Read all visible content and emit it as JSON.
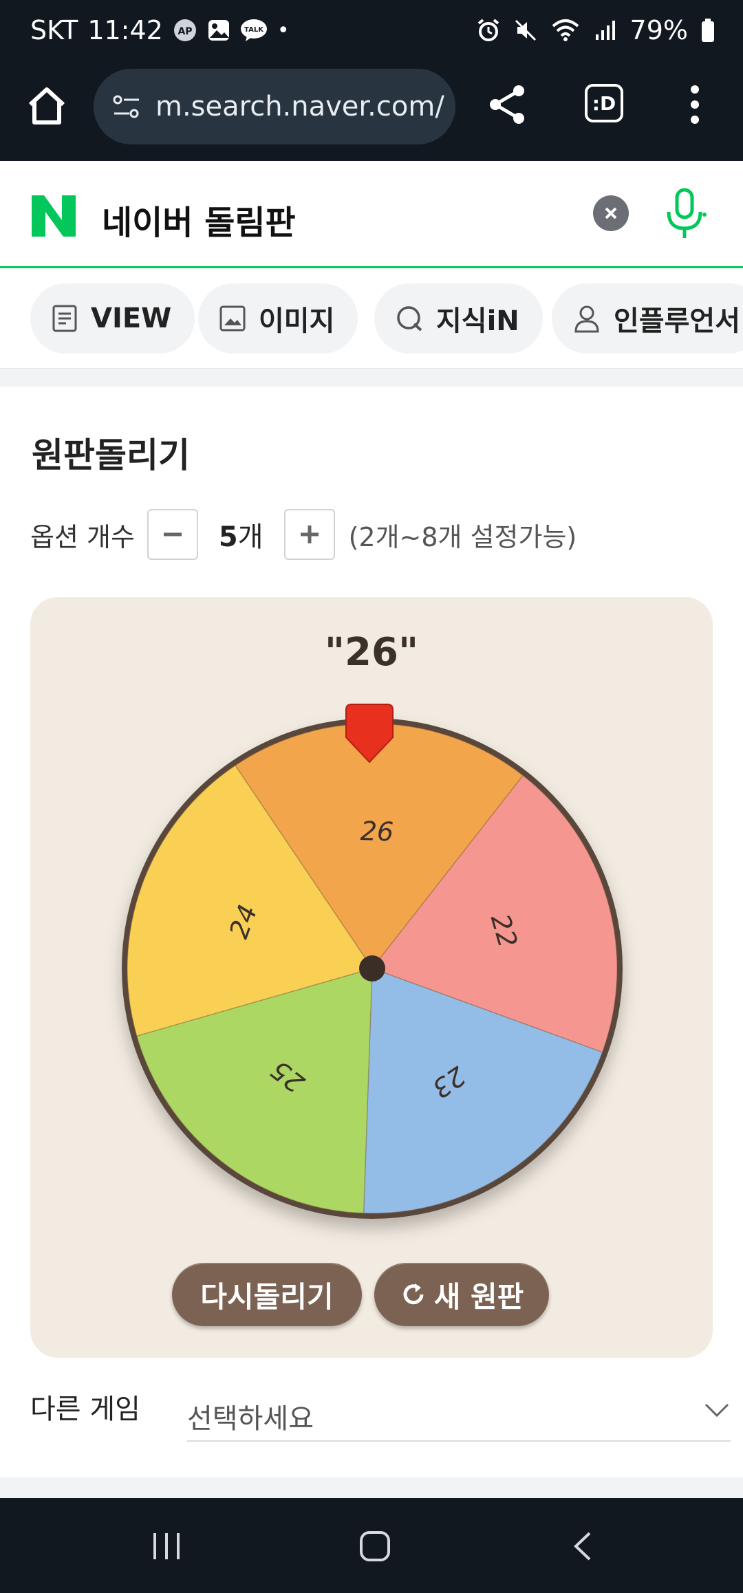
{
  "status_bar": {
    "carrier": "SKT",
    "time": "11:42",
    "talk_badge": "TALK",
    "battery": "79%",
    "dot": "•"
  },
  "browser": {
    "url": "m.search.naver.com/",
    "tabs_label": ":D"
  },
  "search": {
    "query": "네이버 돌림판"
  },
  "tabs": [
    {
      "label": "VIEW",
      "icon": "document-icon"
    },
    {
      "label": "이미지",
      "icon": "image-icon"
    },
    {
      "label": "지식iN",
      "icon": "q-icon"
    },
    {
      "label": "인플루언서",
      "icon": "person-icon"
    }
  ],
  "roulette": {
    "title": "원판돌리기",
    "option_label": "옵션 개수",
    "count_value": "5",
    "count_unit": "개",
    "range_note": "(2개~8개 설정가능)",
    "result": "\"26\"",
    "segments": [
      {
        "label": "26",
        "color": "#f2a54a"
      },
      {
        "label": "22",
        "color": "#f59790"
      },
      {
        "label": "23",
        "color": "#93bde6"
      },
      {
        "label": "25",
        "color": "#add763"
      },
      {
        "label": "24",
        "color": "#f9d054"
      }
    ],
    "spin_again_label": "다시돌리기",
    "new_wheel_label": "새 원판",
    "other_game_label": "다른 게임",
    "select_placeholder": "선택하세요"
  },
  "colors": {
    "naver_green": "#03c75a",
    "button_brown": "#7b6252",
    "pointer_red": "#e8301f"
  }
}
